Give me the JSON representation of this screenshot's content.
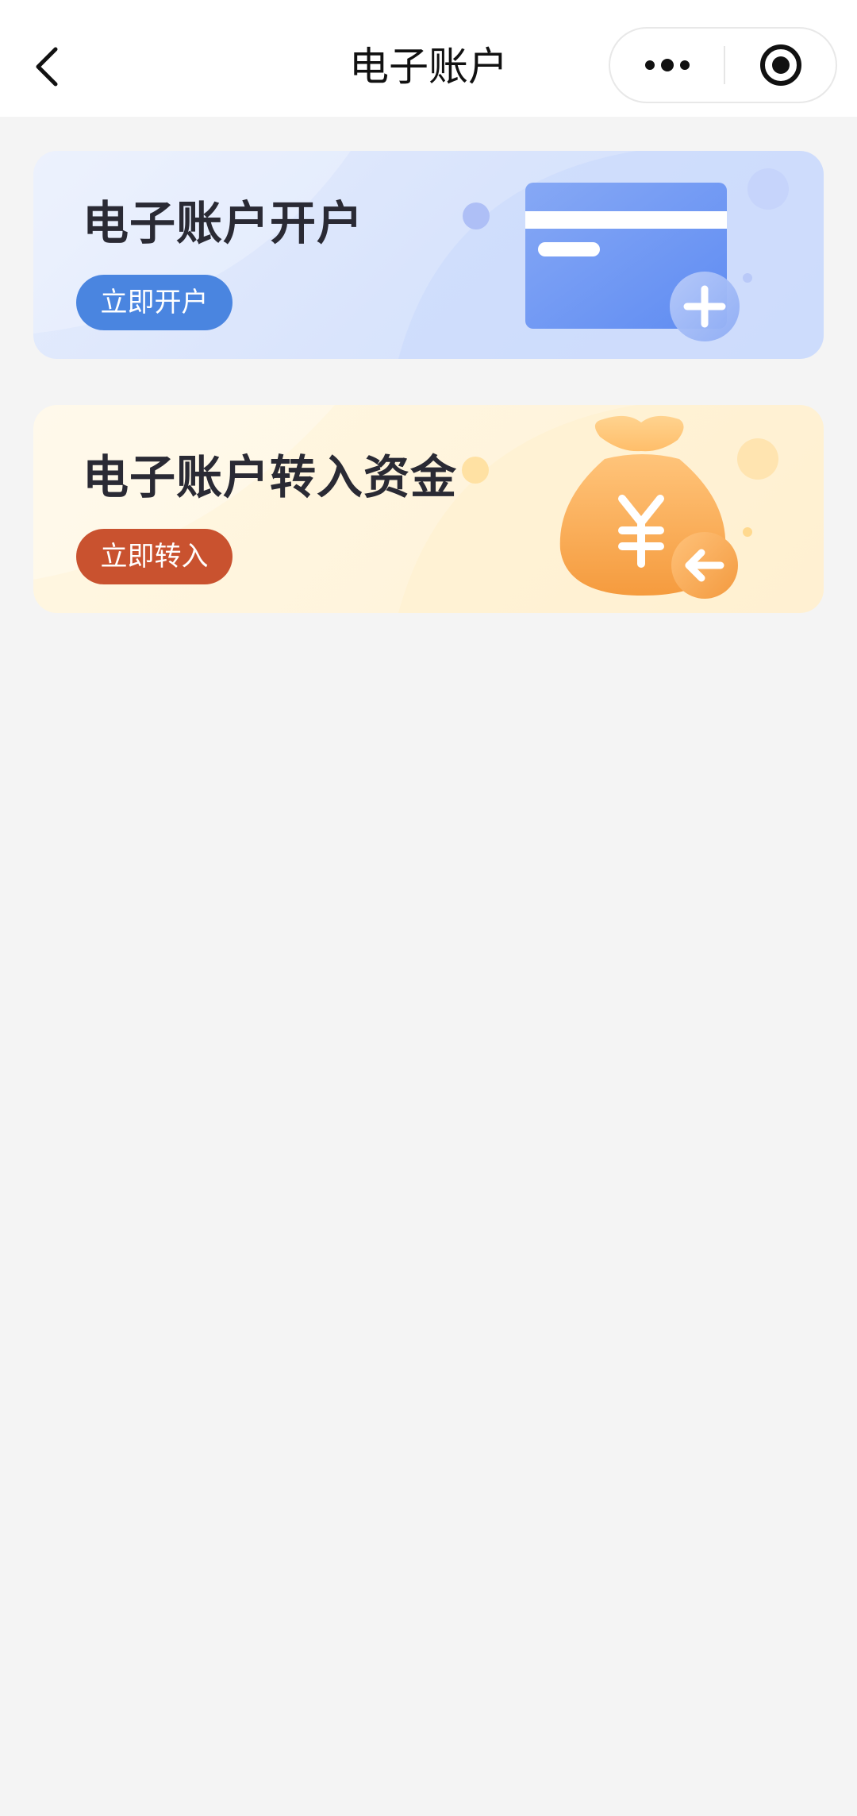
{
  "nav": {
    "title": "电子账户"
  },
  "cards": [
    {
      "title": "电子账户开户",
      "button_label": "立即开户",
      "icon": "bank-card-add-icon",
      "accent": "#4a85e0"
    },
    {
      "title": "电子账户转入资金",
      "button_label": "立即转入",
      "icon": "money-bag-transfer-in-icon",
      "accent": "#c9522f"
    }
  ]
}
